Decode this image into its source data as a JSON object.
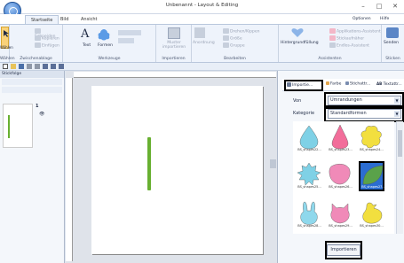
{
  "window": {
    "title": "Unbenannt - Layout & Editing",
    "optionen": "Optionen",
    "hilfe": "Hilfe"
  },
  "tabs": [
    {
      "label": "Startseite"
    },
    {
      "label": "Bild"
    },
    {
      "label": "Ansicht"
    }
  ],
  "ribbon": {
    "waehlen": {
      "label": "Wählen",
      "group": "Wählen"
    },
    "clipboard": {
      "cut": "Schneiden",
      "copy": "Kopieren",
      "paste": "Einfügen",
      "group": "Zwischenablage"
    },
    "tools": {
      "text": "Text",
      "formen": "Formen",
      "group": "Werkzeuge"
    },
    "muster": {
      "label": "Muster importieren",
      "group": "Importieren"
    },
    "bearbeiten": {
      "anordnung": "Anordnung",
      "drehen": "Drehen/Kippen",
      "groesse": "Größe",
      "gruppe": "Gruppe",
      "group": "Bearbeiten"
    },
    "assistenten": {
      "hintergrund": "Hintergrundfüllung",
      "applikation": "Applikations-Assistent",
      "stickaufnaeher": "Stickaufnäher",
      "endlos": "Endlos-Assistent",
      "group": "Assistenten"
    },
    "senden": {
      "label": "Senden",
      "group": "Sticken"
    }
  },
  "leftpanel": {
    "title": "Stickfolge",
    "item_number": "1"
  },
  "rightpanel": {
    "tab_import": "Importie...",
    "tab_farbe": "Farbe",
    "tab_stichattr": "Stichattr...",
    "tab_textattr": "Textattr...",
    "von_label": "Von",
    "von_value": "Umrandungen",
    "kategorie_label": "Kategorie",
    "kategorie_value": "Standardformen",
    "import_button": "Importieren"
  },
  "gallery": [
    {
      "caption": "BS_shapes22...",
      "color": "#7fd1e6",
      "shape": "drop"
    },
    {
      "caption": "BS_shapes23...",
      "color": "#f26d9a",
      "shape": "drop2"
    },
    {
      "caption": "BS_shapes24...",
      "color": "#f2df3f",
      "shape": "blob"
    },
    {
      "caption": "BS_shapes25...",
      "color": "#7fd1e6",
      "shape": "sun"
    },
    {
      "caption": "BS_shapes26...",
      "color": "#f08ab8",
      "shape": "scribble"
    },
    {
      "caption": "BS_shapes27...",
      "color": "#5aa24a",
      "shape": "leaf"
    },
    {
      "caption": "BS_shapes28...",
      "color": "#8fd8ec",
      "shape": "bunny"
    },
    {
      "caption": "BS_shapes29...",
      "color": "#f08ab8",
      "shape": "cat"
    },
    {
      "caption": "BS_shapes30...",
      "color": "#f2df3f",
      "shape": "duck"
    }
  ]
}
